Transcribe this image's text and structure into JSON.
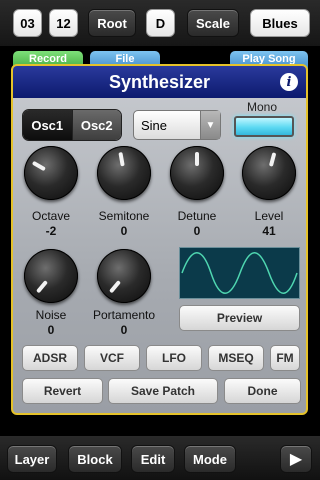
{
  "top_bar": {
    "bar_value": "03",
    "beat_value": "12",
    "root_label": "Root",
    "root_value": "D",
    "scale_label": "Scale",
    "scale_value": "Blues"
  },
  "peek_buttons": {
    "record": "Record",
    "file": "File",
    "play_song": "Play Song"
  },
  "panel": {
    "title": "Synthesizer",
    "osc_tabs": [
      "Osc1",
      "Osc2"
    ],
    "active_osc": "Osc1",
    "waveform": "Sine",
    "mono_label": "Mono",
    "mono_on": true,
    "knobs": [
      {
        "label": "Octave",
        "value": "-2"
      },
      {
        "label": "Semitone",
        "value": "0"
      },
      {
        "label": "Detune",
        "value": "0"
      },
      {
        "label": "Level",
        "value": "41"
      },
      {
        "label": "Noise",
        "value": "0"
      },
      {
        "label": "Portamento",
        "value": "0"
      }
    ],
    "preview_label": "Preview",
    "modules": [
      "ADSR",
      "VCF",
      "LFO",
      "MSEQ",
      "FM"
    ],
    "revert_label": "Revert",
    "save_patch_label": "Save Patch",
    "done_label": "Done"
  },
  "bottom_bar": {
    "layer": "Layer",
    "block": "Block",
    "edit": "Edit",
    "mode": "Mode",
    "play_icon": "play-icon"
  },
  "colors": {
    "header_blue": "#0c1a6e",
    "panel_border": "#e5c22a",
    "mono_led": "#5cd9f2",
    "scope_bg": "#0b3a4a",
    "scope_wave": "#4fd6b0"
  }
}
